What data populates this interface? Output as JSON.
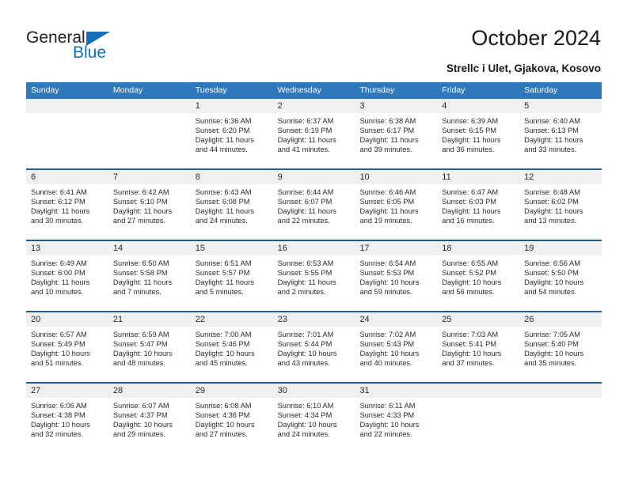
{
  "logo": {
    "word_one": "General",
    "word_two": "Blue",
    "triangle_color": "#1170bb",
    "text_color": "#231f20"
  },
  "header": {
    "title": "October 2024",
    "subtitle": "Strellc i Ulet, Gjakova, Kosovo"
  },
  "colors": {
    "header_bar": "#3078bc",
    "week_separator": "#1f5c99",
    "daynum_band": "#f0f0f0",
    "text": "#2b2b2b"
  },
  "calendar": {
    "day_names": [
      "Sunday",
      "Monday",
      "Tuesday",
      "Wednesday",
      "Thursday",
      "Friday",
      "Saturday"
    ],
    "weeks": [
      [
        {
          "day": "",
          "lines": []
        },
        {
          "day": "",
          "lines": []
        },
        {
          "day": "1",
          "lines": [
            "Sunrise: 6:36 AM",
            "Sunset: 6:20 PM",
            "Daylight: 11 hours",
            "and 44 minutes."
          ]
        },
        {
          "day": "2",
          "lines": [
            "Sunrise: 6:37 AM",
            "Sunset: 6:19 PM",
            "Daylight: 11 hours",
            "and 41 minutes."
          ]
        },
        {
          "day": "3",
          "lines": [
            "Sunrise: 6:38 AM",
            "Sunset: 6:17 PM",
            "Daylight: 11 hours",
            "and 39 minutes."
          ]
        },
        {
          "day": "4",
          "lines": [
            "Sunrise: 6:39 AM",
            "Sunset: 6:15 PM",
            "Daylight: 11 hours",
            "and 36 minutes."
          ]
        },
        {
          "day": "5",
          "lines": [
            "Sunrise: 6:40 AM",
            "Sunset: 6:13 PM",
            "Daylight: 11 hours",
            "and 33 minutes."
          ]
        }
      ],
      [
        {
          "day": "6",
          "lines": [
            "Sunrise: 6:41 AM",
            "Sunset: 6:12 PM",
            "Daylight: 11 hours",
            "and 30 minutes."
          ]
        },
        {
          "day": "7",
          "lines": [
            "Sunrise: 6:42 AM",
            "Sunset: 6:10 PM",
            "Daylight: 11 hours",
            "and 27 minutes."
          ]
        },
        {
          "day": "8",
          "lines": [
            "Sunrise: 6:43 AM",
            "Sunset: 6:08 PM",
            "Daylight: 11 hours",
            "and 24 minutes."
          ]
        },
        {
          "day": "9",
          "lines": [
            "Sunrise: 6:44 AM",
            "Sunset: 6:07 PM",
            "Daylight: 11 hours",
            "and 22 minutes."
          ]
        },
        {
          "day": "10",
          "lines": [
            "Sunrise: 6:46 AM",
            "Sunset: 6:05 PM",
            "Daylight: 11 hours",
            "and 19 minutes."
          ]
        },
        {
          "day": "11",
          "lines": [
            "Sunrise: 6:47 AM",
            "Sunset: 6:03 PM",
            "Daylight: 11 hours",
            "and 16 minutes."
          ]
        },
        {
          "day": "12",
          "lines": [
            "Sunrise: 6:48 AM",
            "Sunset: 6:02 PM",
            "Daylight: 11 hours",
            "and 13 minutes."
          ]
        }
      ],
      [
        {
          "day": "13",
          "lines": [
            "Sunrise: 6:49 AM",
            "Sunset: 6:00 PM",
            "Daylight: 11 hours",
            "and 10 minutes."
          ]
        },
        {
          "day": "14",
          "lines": [
            "Sunrise: 6:50 AM",
            "Sunset: 5:58 PM",
            "Daylight: 11 hours",
            "and 7 minutes."
          ]
        },
        {
          "day": "15",
          "lines": [
            "Sunrise: 6:51 AM",
            "Sunset: 5:57 PM",
            "Daylight: 11 hours",
            "and 5 minutes."
          ]
        },
        {
          "day": "16",
          "lines": [
            "Sunrise: 6:53 AM",
            "Sunset: 5:55 PM",
            "Daylight: 11 hours",
            "and 2 minutes."
          ]
        },
        {
          "day": "17",
          "lines": [
            "Sunrise: 6:54 AM",
            "Sunset: 5:53 PM",
            "Daylight: 10 hours",
            "and 59 minutes."
          ]
        },
        {
          "day": "18",
          "lines": [
            "Sunrise: 6:55 AM",
            "Sunset: 5:52 PM",
            "Daylight: 10 hours",
            "and 56 minutes."
          ]
        },
        {
          "day": "19",
          "lines": [
            "Sunrise: 6:56 AM",
            "Sunset: 5:50 PM",
            "Daylight: 10 hours",
            "and 54 minutes."
          ]
        }
      ],
      [
        {
          "day": "20",
          "lines": [
            "Sunrise: 6:57 AM",
            "Sunset: 5:49 PM",
            "Daylight: 10 hours",
            "and 51 minutes."
          ]
        },
        {
          "day": "21",
          "lines": [
            "Sunrise: 6:59 AM",
            "Sunset: 5:47 PM",
            "Daylight: 10 hours",
            "and 48 minutes."
          ]
        },
        {
          "day": "22",
          "lines": [
            "Sunrise: 7:00 AM",
            "Sunset: 5:46 PM",
            "Daylight: 10 hours",
            "and 45 minutes."
          ]
        },
        {
          "day": "23",
          "lines": [
            "Sunrise: 7:01 AM",
            "Sunset: 5:44 PM",
            "Daylight: 10 hours",
            "and 43 minutes."
          ]
        },
        {
          "day": "24",
          "lines": [
            "Sunrise: 7:02 AM",
            "Sunset: 5:43 PM",
            "Daylight: 10 hours",
            "and 40 minutes."
          ]
        },
        {
          "day": "25",
          "lines": [
            "Sunrise: 7:03 AM",
            "Sunset: 5:41 PM",
            "Daylight: 10 hours",
            "and 37 minutes."
          ]
        },
        {
          "day": "26",
          "lines": [
            "Sunrise: 7:05 AM",
            "Sunset: 5:40 PM",
            "Daylight: 10 hours",
            "and 35 minutes."
          ]
        }
      ],
      [
        {
          "day": "27",
          "lines": [
            "Sunrise: 6:06 AM",
            "Sunset: 4:38 PM",
            "Daylight: 10 hours",
            "and 32 minutes."
          ]
        },
        {
          "day": "28",
          "lines": [
            "Sunrise: 6:07 AM",
            "Sunset: 4:37 PM",
            "Daylight: 10 hours",
            "and 29 minutes."
          ]
        },
        {
          "day": "29",
          "lines": [
            "Sunrise: 6:08 AM",
            "Sunset: 4:36 PM",
            "Daylight: 10 hours",
            "and 27 minutes."
          ]
        },
        {
          "day": "30",
          "lines": [
            "Sunrise: 6:10 AM",
            "Sunset: 4:34 PM",
            "Daylight: 10 hours",
            "and 24 minutes."
          ]
        },
        {
          "day": "31",
          "lines": [
            "Sunrise: 6:11 AM",
            "Sunset: 4:33 PM",
            "Daylight: 10 hours",
            "and 22 minutes."
          ]
        },
        {
          "day": "",
          "lines": []
        },
        {
          "day": "",
          "lines": []
        }
      ]
    ]
  }
}
